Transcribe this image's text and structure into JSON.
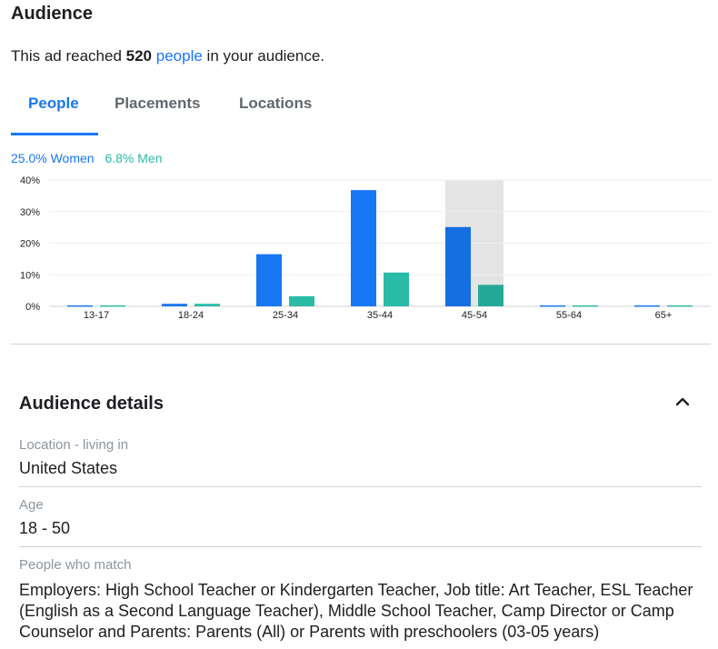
{
  "audience": {
    "title": "Audience",
    "reach_prefix": "This ad reached",
    "reach_count": "520",
    "reach_link": "people",
    "reach_suffix": "in your audience."
  },
  "tabs": [
    {
      "label": "People",
      "active": true
    },
    {
      "label": "Placements",
      "active": false
    },
    {
      "label": "Locations",
      "active": false
    }
  ],
  "legend": {
    "women": "25.0% Women",
    "men": "6.8% Men"
  },
  "colors": {
    "accent": "#1877f2",
    "women": "#1877f2",
    "men": "#2abba7",
    "women_hover": "#166fe0",
    "men_hover": "#26a898",
    "highlight": "#e4e4e4"
  },
  "chart_data": {
    "type": "bar",
    "categories": [
      "13-17",
      "18-24",
      "25-34",
      "35-44",
      "45-54",
      "55-64",
      "65+"
    ],
    "series": [
      {
        "name": "Women",
        "values": [
          0.3,
          0.8,
          16.5,
          36.8,
          25.1,
          0.3,
          0.3
        ]
      },
      {
        "name": "Men",
        "values": [
          0.3,
          0.8,
          3.2,
          10.7,
          6.8,
          0.3,
          0.3
        ]
      }
    ],
    "yticks": [
      "0%",
      "10%",
      "20%",
      "30%",
      "40%"
    ],
    "ylim": [
      0,
      40
    ],
    "highlighted_category": "45-54",
    "grid": true
  },
  "details": {
    "title": "Audience details",
    "items": [
      {
        "label": "Location - living in",
        "value": "United States"
      },
      {
        "label": "Age",
        "value": "18 - 50"
      },
      {
        "label": "People who match",
        "value": "Employers: High School Teacher or Kindergarten Teacher, Job title: Art Teacher, ESL Teacher (English as a Second Language Teacher), Middle School Teacher, Camp Director or Camp Counselor and Parents: Parents (All) or Parents with preschoolers (03-05 years)"
      }
    ]
  }
}
